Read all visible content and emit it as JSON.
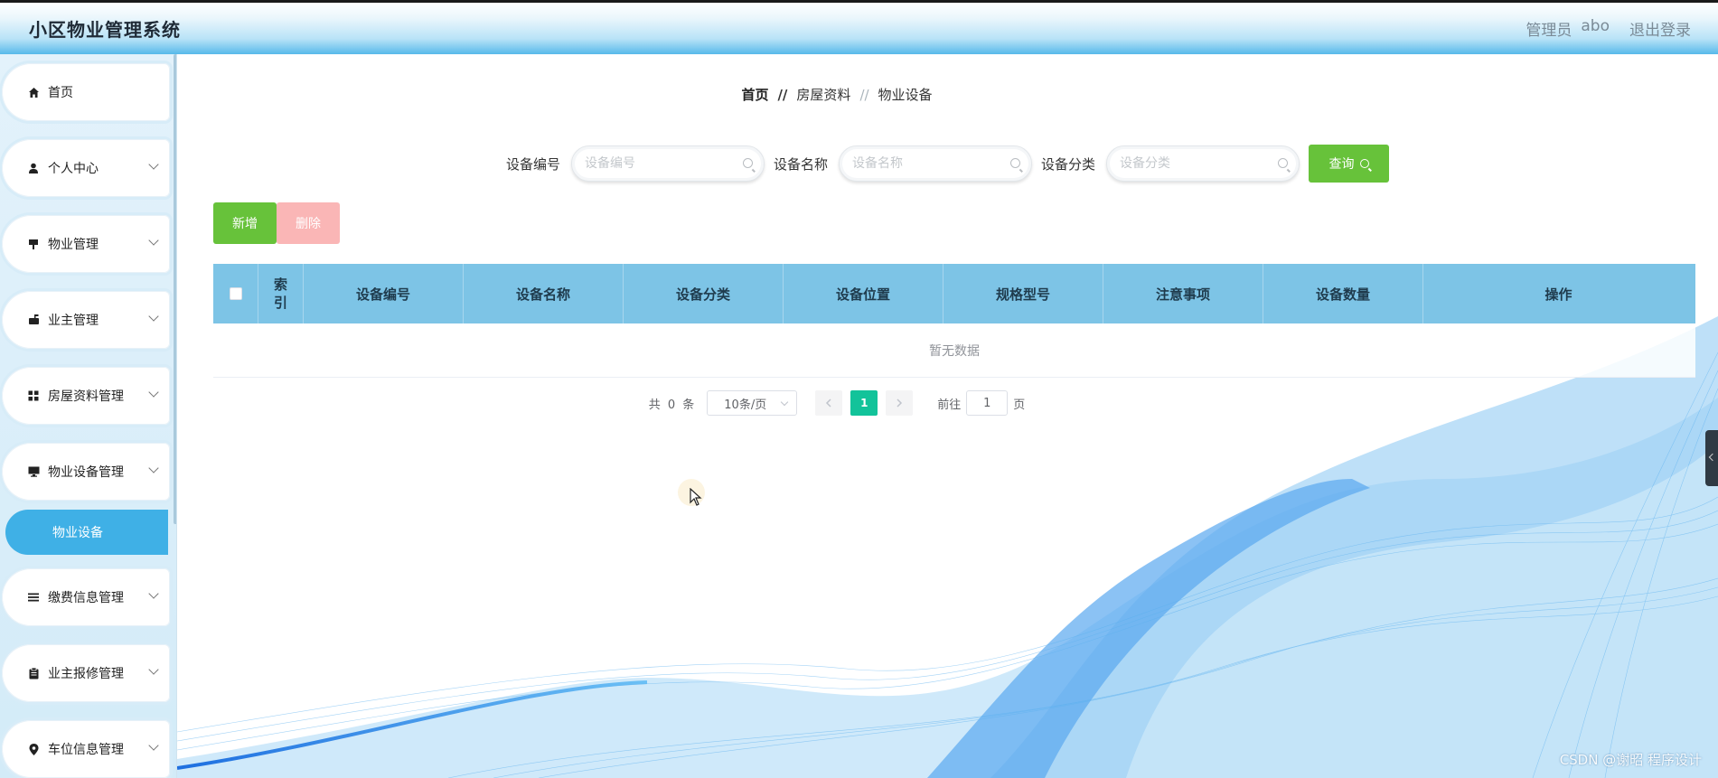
{
  "header": {
    "title": "小区物业管理系统",
    "role": "管理员",
    "username": "abo",
    "logout": "退出登录"
  },
  "sidebar": {
    "items": [
      {
        "label": "首页",
        "icon": "home-icon"
      },
      {
        "label": "个人中心",
        "icon": "user-icon"
      },
      {
        "label": "物业管理",
        "icon": "sign-icon"
      },
      {
        "label": "业主管理",
        "icon": "mailbox-icon"
      },
      {
        "label": "房屋资料管理",
        "icon": "grid-icon"
      },
      {
        "label": "物业设备管理",
        "icon": "monitor-icon"
      },
      {
        "label": "缴费信息管理",
        "icon": "list-icon"
      },
      {
        "label": "业主报修管理",
        "icon": "clipboard-icon"
      },
      {
        "label": "车位信息管理",
        "icon": "pin-icon"
      }
    ],
    "active_sub": "物业设备"
  },
  "breadcrumb": {
    "home": "首页",
    "sep1": "//",
    "level2": "房屋资料",
    "sep2": "//",
    "level3": "物业设备"
  },
  "search": {
    "fields": [
      {
        "label": "设备编号",
        "placeholder": "设备编号",
        "value": ""
      },
      {
        "label": "设备名称",
        "placeholder": "设备名称",
        "value": ""
      },
      {
        "label": "设备分类",
        "placeholder": "设备分类",
        "value": ""
      }
    ],
    "query_label": "查询"
  },
  "actions": {
    "add": "新增",
    "delete": "删除"
  },
  "table": {
    "index_header": [
      "索",
      "引"
    ],
    "columns": [
      "设备编号",
      "设备名称",
      "设备分类",
      "设备位置",
      "规格型号",
      "注意事项",
      "设备数量"
    ],
    "op_header": "操作",
    "empty_text": "暂无数据"
  },
  "pagination": {
    "total_prefix": "共",
    "total": "0",
    "total_suffix": "条",
    "page_size": "10条/页",
    "current_page": "1",
    "goto_prefix": "前往",
    "goto_value": "1",
    "goto_suffix": "页"
  },
  "colors": {
    "accent": "#3fb0e6",
    "success": "#67c23a",
    "danger_light": "#fab6b6",
    "table_header": "#7dc4e6",
    "active_page": "#12c39a"
  },
  "watermark": "CSDN @谢昭  程序设计"
}
